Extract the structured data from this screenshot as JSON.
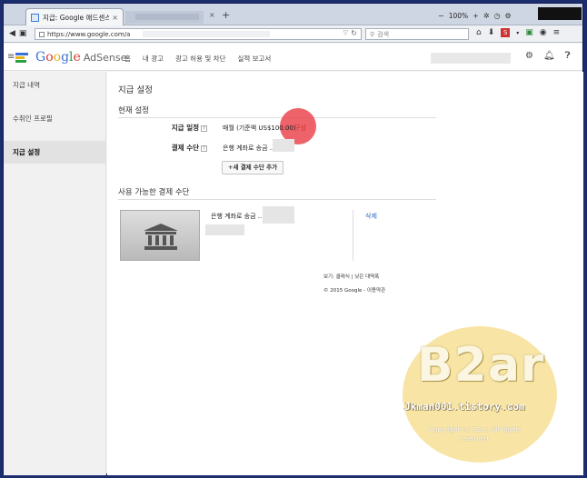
{
  "browser": {
    "tab_title": "지급: Google 애드센스",
    "tab_close": "×",
    "new_tab": "+",
    "url": "https://www.google.com/a",
    "search_placeholder": "검색",
    "zoom": "100%"
  },
  "header": {
    "brand": {
      "g": "G",
      "o1": "o",
      "o2": "o",
      "g2": "g",
      "l": "l",
      "e": "e",
      "product": "AdSense"
    },
    "nav": [
      "홈",
      "내 광고",
      "광고 허용 및 차단",
      "실적 보고서"
    ]
  },
  "sidebar": {
    "items": [
      {
        "label": "지급 내역",
        "active": false
      },
      {
        "label": "수취인 프로필",
        "active": false
      },
      {
        "label": "지급 설정",
        "active": true
      }
    ]
  },
  "main": {
    "page_title": "지급 설정",
    "current_settings_title": "현재 설정",
    "schedule_label": "지급 일정",
    "schedule_value": "매월 (기준액 US$100.00)",
    "schedule_link": "구성",
    "method_label": "결제 수단",
    "method_value": "은행 계좌로 송금 ...",
    "add_button": "+새 결제 수단 추가",
    "available_title": "사용 가능한 결제 수단",
    "card_text": "은행 계좌로 송금 ...",
    "delete_link": "삭제",
    "footer_view": "보기: 클래식 | 낮은 대역폭",
    "footer_copy": "© 2015 Google - 이용약관",
    "qmark": "?"
  },
  "watermark": {
    "title": "B2ar",
    "url": "Jkman001.tistory.com",
    "copyright": "Copyright (c) B2ar, All Rights reserved."
  },
  "colors": {
    "accent_link": "#c43a2a",
    "highlight": "#eb4650",
    "blue_link": "#2a66c7"
  }
}
